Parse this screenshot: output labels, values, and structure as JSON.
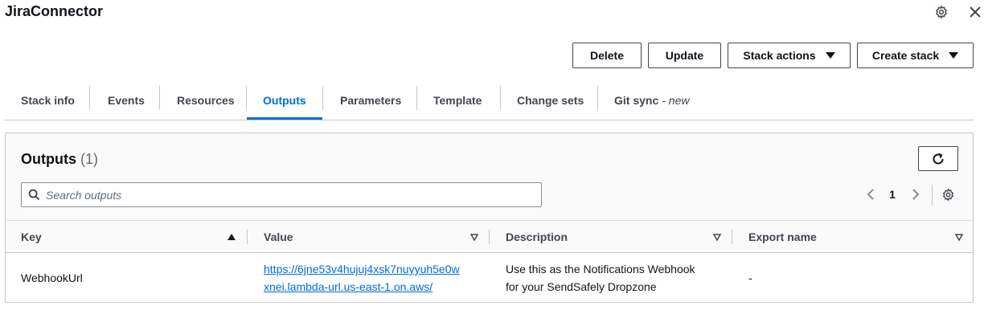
{
  "header": {
    "title": "JiraConnector",
    "icons": [
      "gear-icon",
      "close-icon"
    ]
  },
  "actions": {
    "delete_label": "Delete",
    "update_label": "Update",
    "stack_actions_label": "Stack actions",
    "create_stack_label": "Create stack"
  },
  "tabs": [
    {
      "label": "Stack info"
    },
    {
      "label": "Events"
    },
    {
      "label": "Resources"
    },
    {
      "label": "Outputs",
      "active": true
    },
    {
      "label": "Parameters"
    },
    {
      "label": "Template"
    },
    {
      "label": "Change sets"
    },
    {
      "label": "Git sync",
      "suffix": "- new"
    }
  ],
  "outputs": {
    "title": "Outputs",
    "count": "(1)",
    "search_placeholder": "Search outputs",
    "page": "1",
    "columns": [
      "Key",
      "Value",
      "Description",
      "Export name"
    ],
    "rows": [
      {
        "key": "WebhookUrl",
        "value_line1": "https://6jne53v4hujuj4xsk7nuyyuh5e0w",
        "value_line2": "xnei.lambda-url.us-east-1.on.aws/",
        "description_line1": "Use this as the Notifications Webhook",
        "description_line2": "for your SendSafely Dropzone",
        "export_name": "-"
      }
    ]
  },
  "colors": {
    "accent": "#006ce0",
    "text": "#0f141a",
    "border": "#c6c6cd"
  }
}
